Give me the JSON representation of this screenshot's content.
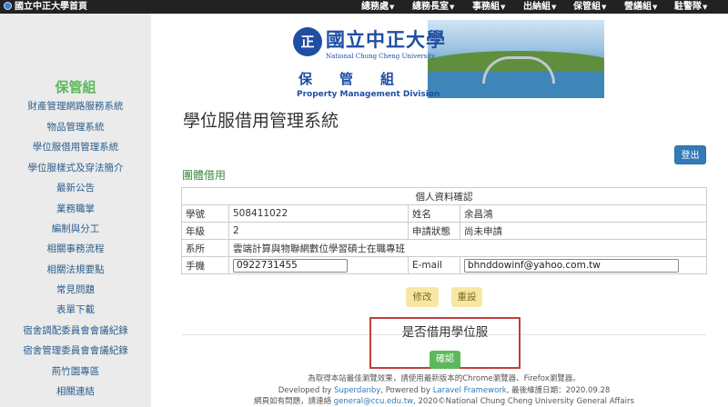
{
  "navbar": {
    "brand": "國立中正大學首頁",
    "items": [
      {
        "label": "總務處"
      },
      {
        "label": "總務長室"
      },
      {
        "label": "事務組"
      },
      {
        "label": "出納組"
      },
      {
        "label": "保管組"
      },
      {
        "label": "營繕組"
      },
      {
        "label": "駐警隊"
      }
    ]
  },
  "banner": {
    "university_zh": "國立中正大學",
    "university_en": "National Chung Cheng University",
    "division_zh": "保管組",
    "division_en": "Property Management Division"
  },
  "sidebar": {
    "title": "保管組",
    "items": [
      {
        "label": "財產管理網路服務系統"
      },
      {
        "label": "物品管理系統"
      },
      {
        "label": "學位服借用管理系統"
      },
      {
        "label": "學位服樣式及穿法簡介"
      },
      {
        "label": "最新公告"
      },
      {
        "label": "業務職掌"
      },
      {
        "label": "編制與分工"
      },
      {
        "label": "相關事務流程"
      },
      {
        "label": "相關法規要點"
      },
      {
        "label": "常見問題"
      },
      {
        "label": "表單下載"
      },
      {
        "label": "宿舍調配委員會會議紀錄"
      },
      {
        "label": "宿舍管理委員會會議紀錄"
      },
      {
        "label": "荊竹園專區"
      },
      {
        "label": "相關連結"
      }
    ]
  },
  "main": {
    "page_title": "學位服借用管理系統",
    "logout_label": "登出",
    "section_heading": "團體借用",
    "table": {
      "caption": "個人資料確認",
      "student_id_label": "學號",
      "student_id": "508411022",
      "name_label": "姓名",
      "name": "余昌鴻",
      "grade_label": "年級",
      "grade": "2",
      "status_label": "申請狀態",
      "status": "尚未申請",
      "department_label": "系所",
      "department": "雲端計算與物聯網數位學習碩士在職專班",
      "phone_label": "手機",
      "phone": "0922731455",
      "email_label": "E-mail",
      "email": "bhnddowinf@yahoo.com.tw"
    },
    "edit_label": "修改",
    "reset_label": "重設",
    "borrow_question": "是否借用學位服",
    "confirm_label": "確認"
  },
  "footer": {
    "line1": "為取得本站最佳瀏覽效果，請使用最新版本的Chrome瀏覽器、Firefox瀏覽器。",
    "line2_prefix": "Developed by ",
    "line2_dev": "Superdanby",
    "line2_mid": ", Powered by ",
    "line2_framework": "Laravel Framework",
    "line2_suffix": ", 最後維護日期：2020.09.28",
    "line3_prefix": "網頁如有問題，請連絡 ",
    "line3_email": "general@ccu.edu.tw",
    "line3_suffix": ", 2020©National Chung Cheng University General Affairs"
  }
}
